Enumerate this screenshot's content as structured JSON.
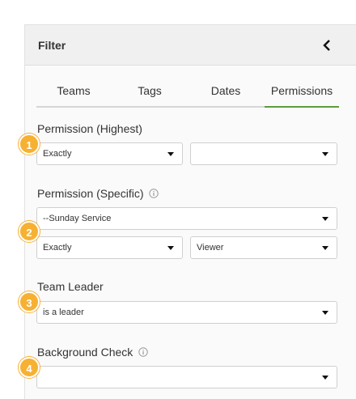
{
  "panel": {
    "title": "Filter"
  },
  "tabs": [
    {
      "label": "Teams",
      "active": false
    },
    {
      "label": "Tags",
      "active": false
    },
    {
      "label": "Dates",
      "active": false
    },
    {
      "label": "Permissions",
      "active": true
    }
  ],
  "sections": {
    "permission_highest": {
      "badge": "1",
      "label": "Permission (Highest)",
      "operator": "Exactly",
      "value": ""
    },
    "permission_specific": {
      "badge": "2",
      "label": "Permission (Specific)",
      "team": "--Sunday Service",
      "operator": "Exactly",
      "value": "Viewer"
    },
    "team_leader": {
      "badge": "3",
      "label": "Team Leader",
      "value": "is a leader"
    },
    "background_check": {
      "badge": "4",
      "label": "Background Check",
      "value": ""
    }
  },
  "colors": {
    "accent": "#5e9b3e",
    "badge": "#f6b133"
  }
}
